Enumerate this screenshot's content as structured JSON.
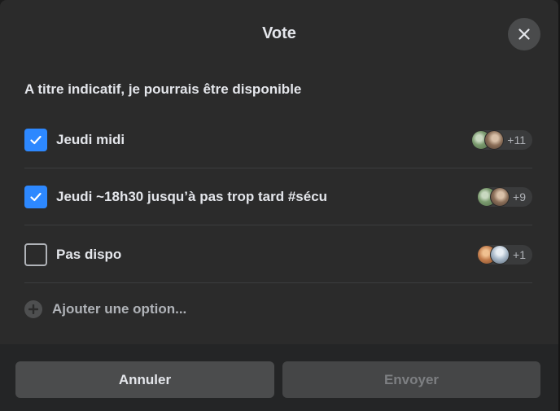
{
  "dialog": {
    "title": "Vote",
    "question": "A titre indicatif, je pourrais être disponible"
  },
  "options": [
    {
      "label": "Jeudi midi",
      "checked": true,
      "voters_extra": "+11",
      "avatar_colors": [
        "#7a9a6e",
        "#8a6e58"
      ]
    },
    {
      "label": "Jeudi ~18h30 jusqu’à pas trop tard #sécu",
      "checked": true,
      "voters_extra": "+9",
      "avatar_colors": [
        "#7a9a6e",
        "#8a6e58"
      ]
    },
    {
      "label": "Pas dispo",
      "checked": false,
      "voters_extra": "+1",
      "avatar_colors": [
        "#c07a4a",
        "#a8b8c8"
      ]
    }
  ],
  "add_option_label": "Ajouter une option...",
  "footer": {
    "cancel_label": "Annuler",
    "submit_label": "Envoyer"
  },
  "icons": {
    "close": "close-icon",
    "check": "check-icon",
    "add": "plus-circle-icon"
  },
  "colors": {
    "accent": "#2d88ff",
    "dialog_bg": "#2b2b2b",
    "footer_bg": "#242526"
  }
}
